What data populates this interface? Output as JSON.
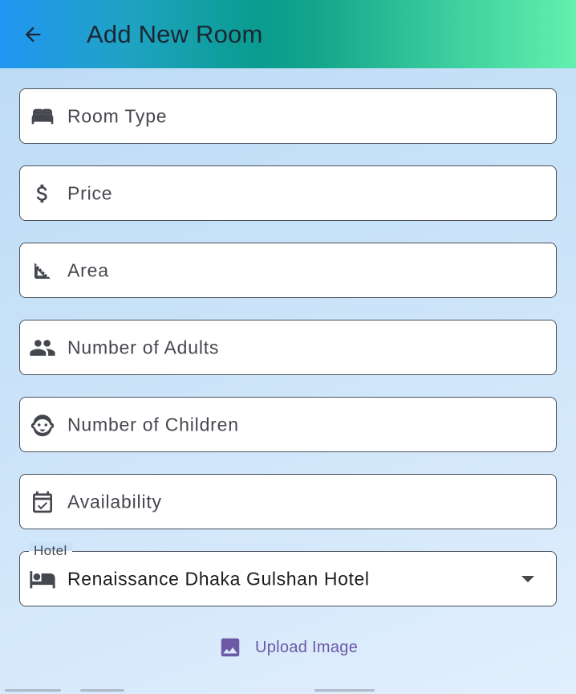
{
  "app_bar": {
    "title": "Add New Room",
    "back_icon": "arrow-back-icon"
  },
  "form": {
    "fields": [
      {
        "label": "Room Type",
        "icon": "bed-icon"
      },
      {
        "label": "Price",
        "icon": "dollar-icon"
      },
      {
        "label": "Area",
        "icon": "square-foot-icon"
      },
      {
        "label": "Number of Adults",
        "icon": "people-icon"
      },
      {
        "label": "Number of Children",
        "icon": "child-face-icon"
      },
      {
        "label": "Availability",
        "icon": "calendar-check-icon"
      }
    ],
    "hotel_dropdown": {
      "label": "Hotel",
      "selected": "Renaissance Dhaka Gulshan Hotel",
      "icon": "hotel-icon",
      "caret_icon": "arrow-drop-down-icon"
    },
    "upload": {
      "label": "Upload Image",
      "icon": "image-icon"
    }
  },
  "colors": {
    "accent": "#6c58a5",
    "outline": "#48505a",
    "icon": "#44474e",
    "title": "#1b2633"
  }
}
